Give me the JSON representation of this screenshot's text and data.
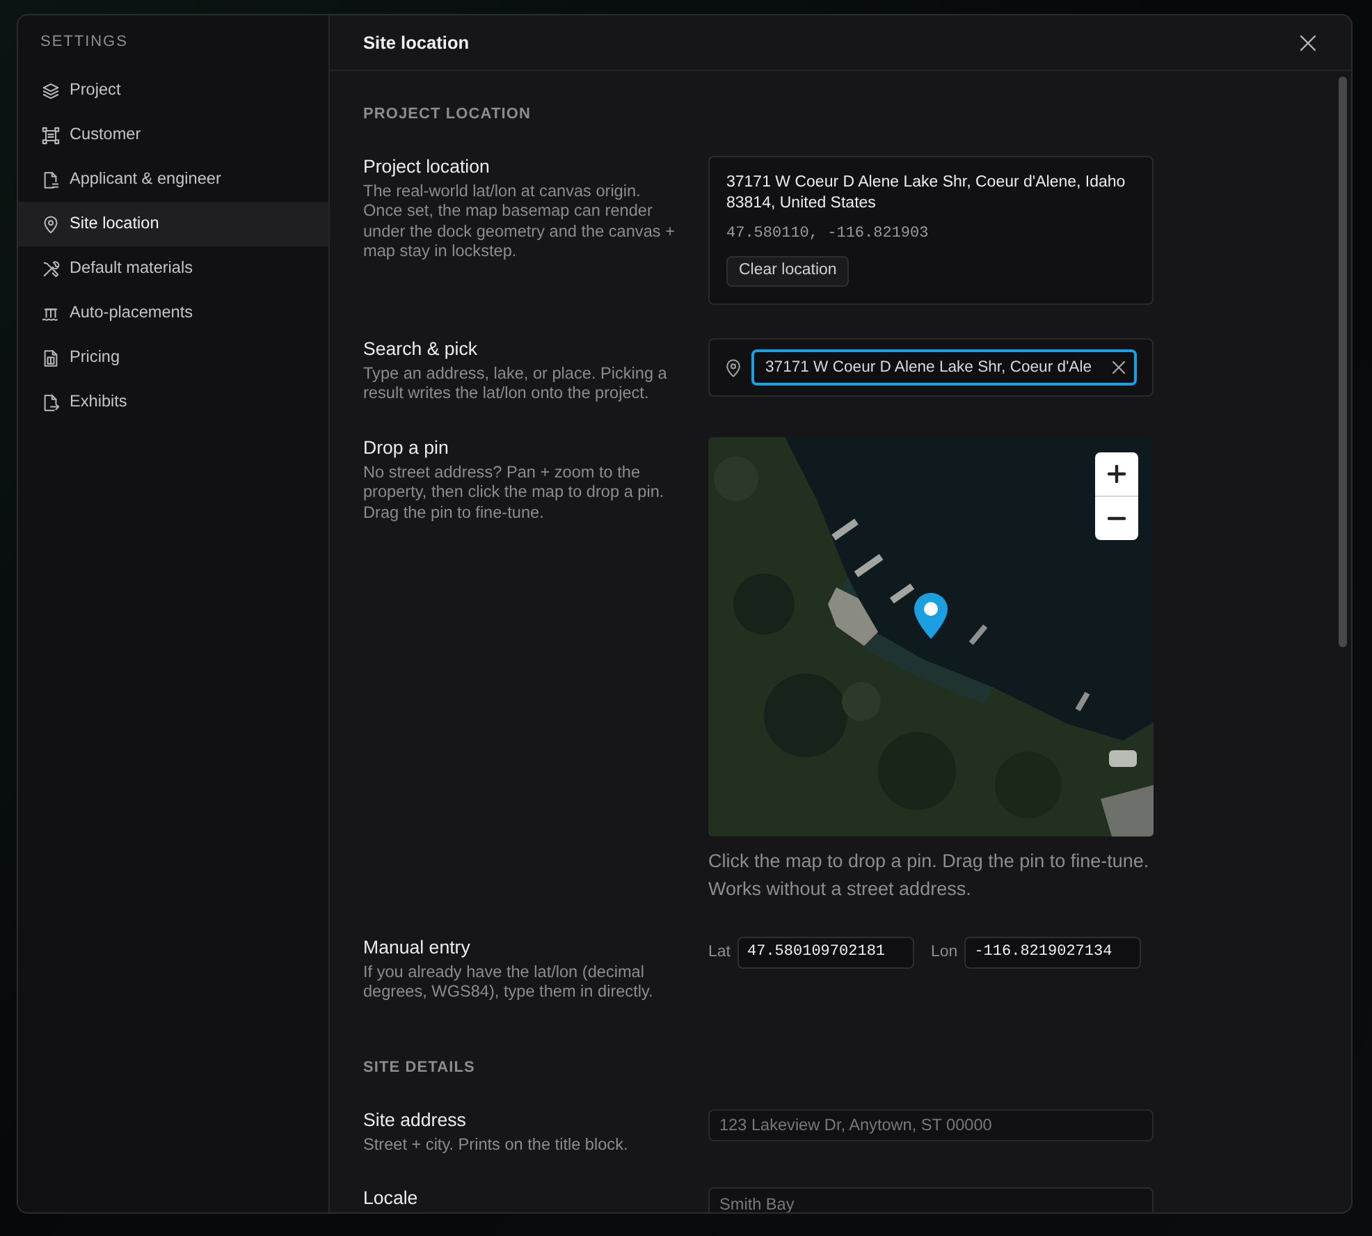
{
  "sidebar": {
    "heading": "SETTINGS",
    "items": [
      {
        "label": "Project",
        "selected": false
      },
      {
        "label": "Customer",
        "selected": false
      },
      {
        "label": "Applicant & engineer",
        "selected": false
      },
      {
        "label": "Site location",
        "selected": true
      },
      {
        "label": "Default materials",
        "selected": false
      },
      {
        "label": "Auto-placements",
        "selected": false
      },
      {
        "label": "Pricing",
        "selected": false
      },
      {
        "label": "Exhibits",
        "selected": false
      }
    ]
  },
  "dialog": {
    "title": "Site location"
  },
  "sections": [
    {
      "heading": "PROJECT LOCATION",
      "rows": [
        {
          "kind": "location",
          "label": "Project location",
          "description": "The real-world lat/lon at canvas origin. Once set, the map basemap can render under the dock geometry and the canvas + map stay in lockstep.",
          "address": "37171 W Coeur D Alene Lake Shr, Coeur d'Alene, Idaho 83814, United States",
          "coordinates": "47.580110, -116.821903",
          "button": "Clear location"
        },
        {
          "kind": "search",
          "label": "Search & pick",
          "description": "Type an address, lake, or place. Picking a result writes the lat/lon onto the project.",
          "value": "37171 W Coeur D Alene Lake Shr, Coeur d'Ale",
          "focused": true
        },
        {
          "kind": "map",
          "label": "Drop a pin",
          "description": "No street address? Pan + zoom to the property, then click the map to drop a pin. Drag the pin to fine-tune.",
          "caption": "Click the map to drop a pin. Drag the pin to fine-tune. Works without a street address."
        },
        {
          "kind": "coordinates",
          "label": "Manual entry",
          "description": "If you already have the lat/lon (decimal degrees, WGS84), type them in directly.",
          "lat_label": "Lat",
          "lat": "47.580109702181",
          "lon_label": "Lon",
          "lon": "-116.8219027134"
        }
      ]
    },
    {
      "heading": "SITE DETAILS",
      "rows": [
        {
          "kind": "text",
          "label": "Site address",
          "description": "Street + city. Prints on the title block.",
          "placeholder": "123 Lakeview Dr, Anytown, ST 00000"
        },
        {
          "kind": "text",
          "label": "Locale",
          "placeholder": "Smith Bay"
        }
      ]
    }
  ]
}
